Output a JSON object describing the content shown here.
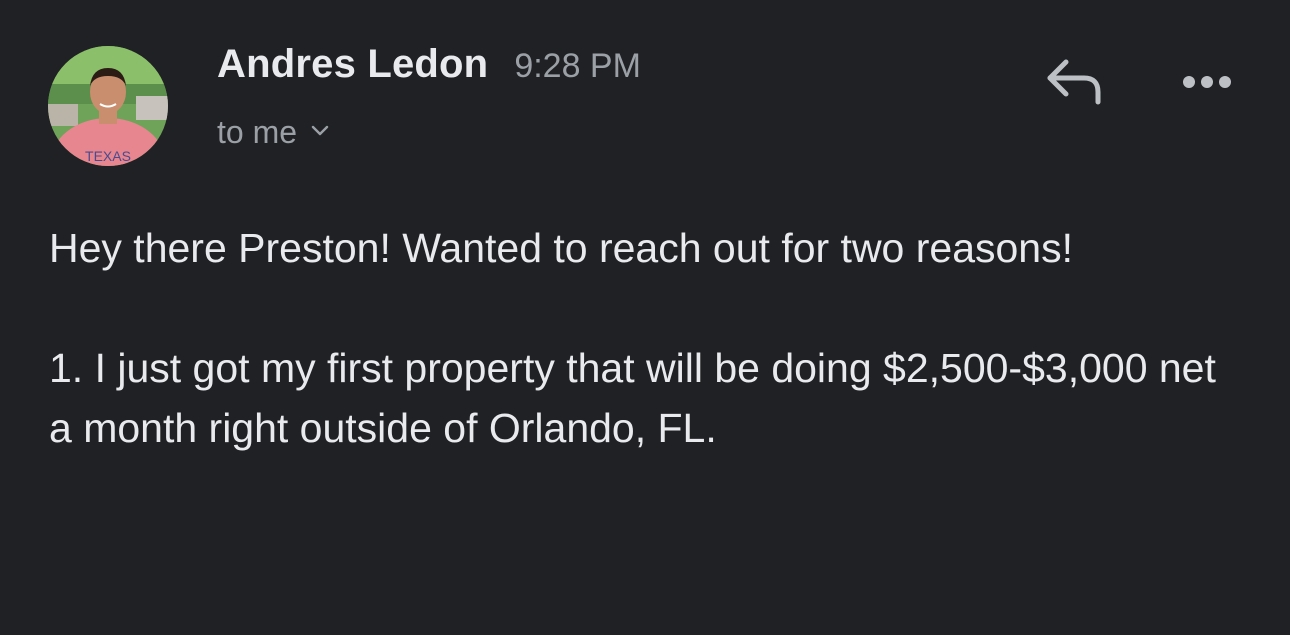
{
  "header": {
    "sender_name": "Andres Ledon",
    "timestamp": "9:28 PM",
    "recipient_label": "to me",
    "avatar_shirt_text": "TEXAS"
  },
  "actions": {
    "reply_icon": "reply-icon",
    "more_icon": "more-horizontal-icon",
    "chevron_icon": "chevron-down-icon"
  },
  "message": {
    "line1": "Hey there Preston! Wanted to reach out for two reasons!",
    "line2": "1. I just got my first property that will be doing $2,500-$3,000 net a month right outside of Orlando, FL."
  },
  "colors": {
    "background": "#202124",
    "primary_text": "#e8eaed",
    "secondary_text": "#9aa0a6"
  }
}
